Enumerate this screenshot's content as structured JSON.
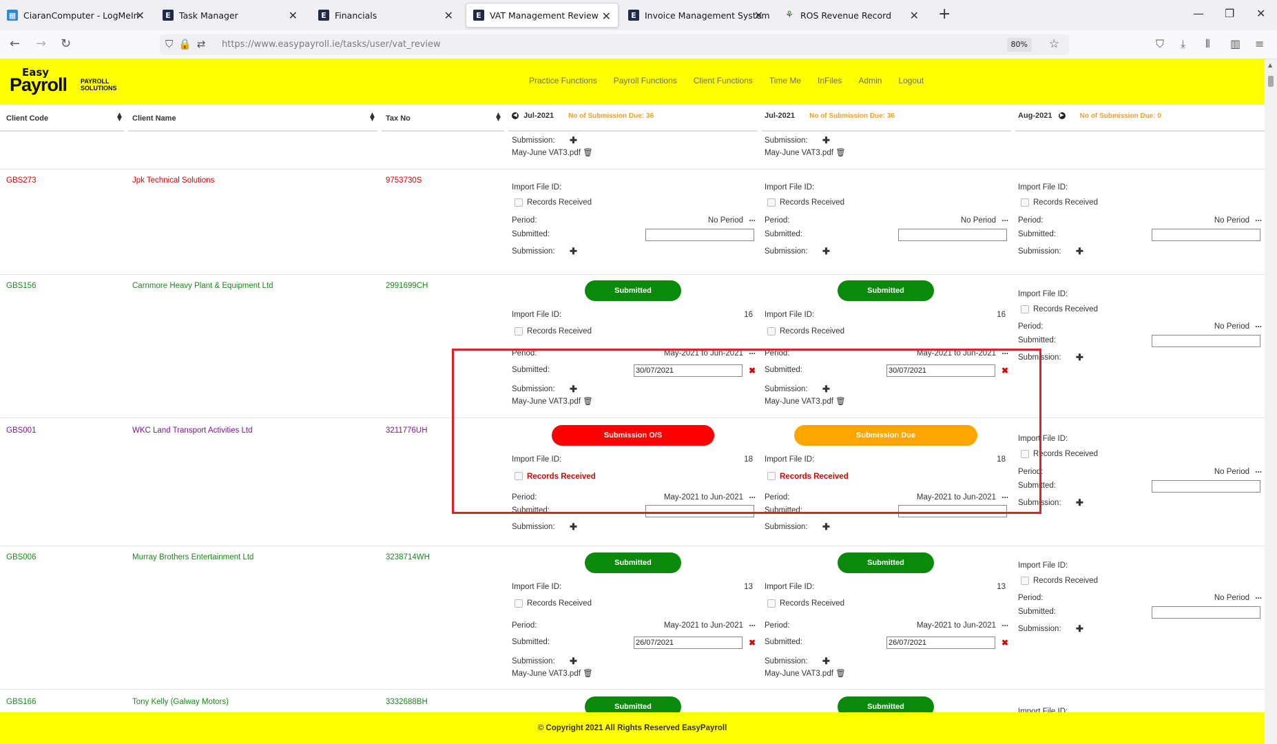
{
  "browser": {
    "tabs": [
      {
        "label": "CiaranComputer - LogMeIn",
        "icon": "logmein-icon"
      },
      {
        "label": "Task Manager",
        "icon": "e-icon"
      },
      {
        "label": "Financials",
        "icon": "e-icon"
      },
      {
        "label": "VAT Management Review",
        "icon": "e-icon",
        "active": true
      },
      {
        "label": "Invoice Management System",
        "icon": "e-icon"
      },
      {
        "label": "ROS Revenue Record",
        "icon": "ros-icon"
      }
    ],
    "url": "https://www.easypayroll.ie/tasks/user/vat_review",
    "zoom": "80%"
  },
  "site": {
    "logo": {
      "top": "Easy",
      "main": "Payroll",
      "sub1": "PAYROLL",
      "sub2": "SOLUTIONS"
    },
    "nav": [
      "Practice Functions",
      "Payroll Functions",
      "Client Functions",
      "Time Me",
      "InFiles",
      "Admin",
      "Logout"
    ],
    "footer": "© Copyright 2021 All Rights Reserved EasyPayroll"
  },
  "table": {
    "headers": {
      "client_code": "Client Code",
      "client_name": "Client Name",
      "tax_no": "Tax No"
    },
    "months": [
      {
        "month": "Jul-2021",
        "due": "No of Submission Due: 36"
      },
      {
        "month": "Jul-2021",
        "due": "No of Submission Due: 36"
      },
      {
        "month": "Aug-2021",
        "due": "No of Submission Due: 0"
      }
    ],
    "labels": {
      "import": "Import File ID:",
      "records": "Records Received",
      "period": "Period:",
      "submitted": "Submitted:",
      "submission": "Submission:",
      "no_period": "No Period",
      "dots": "..."
    },
    "top_row": {
      "file1": "May-June VAT3.pdf",
      "file2": "May-June VAT3.pdf"
    },
    "rows": [
      {
        "code": "GBS273",
        "name": "Jpk Technical Solutions",
        "tax": "9753730S"
      },
      {
        "code": "GBS156",
        "name": "Carnmore Heavy Plant & Equipment Ltd",
        "tax": "2991699CH",
        "status1": "Submitted",
        "status2": "Submitted",
        "id1": "16",
        "id2": "16",
        "period1": "May-2021 to Jun-2021",
        "period2": "May-2021 to Jun-2021",
        "date1": "30/07/2021",
        "date2": "30/07/2021",
        "file1": "May-June VAT3.pdf",
        "file2": "May-June VAT3.pdf"
      },
      {
        "code": "GBS001",
        "name": "WKC Land Transport Activities Ltd",
        "tax": "3211776UH",
        "status1": "Submission O/S",
        "status2": "Submission Due",
        "id1": "18",
        "id2": "18",
        "period1": "May-2021 to Jun-2021",
        "period2": "May-2021 to Jun-2021"
      },
      {
        "code": "GBS006",
        "name": "Murray Brothers Entertainment Ltd",
        "tax": "3238714WH",
        "status1": "Submitted",
        "status2": "Submitted",
        "id1": "13",
        "id2": "13",
        "period1": "May-2021 to Jun-2021",
        "period2": "May-2021 to Jun-2021",
        "date1": "26/07/2021",
        "date2": "26/07/2021",
        "file1": "May-June VAT3.pdf",
        "file2": "May-June VAT3.pdf"
      },
      {
        "code": "GBS166",
        "name": "Tony Kelly (Galway Motors)",
        "tax": "3332688BH",
        "status1": "Submitted",
        "status2": "Submitted"
      }
    ]
  },
  "colors": {
    "header_bg": "#ffff00",
    "submitted": "#0a8a0a",
    "outstanding": "#ff0000",
    "due": "#ffa500",
    "due_text": "#f0a020"
  }
}
